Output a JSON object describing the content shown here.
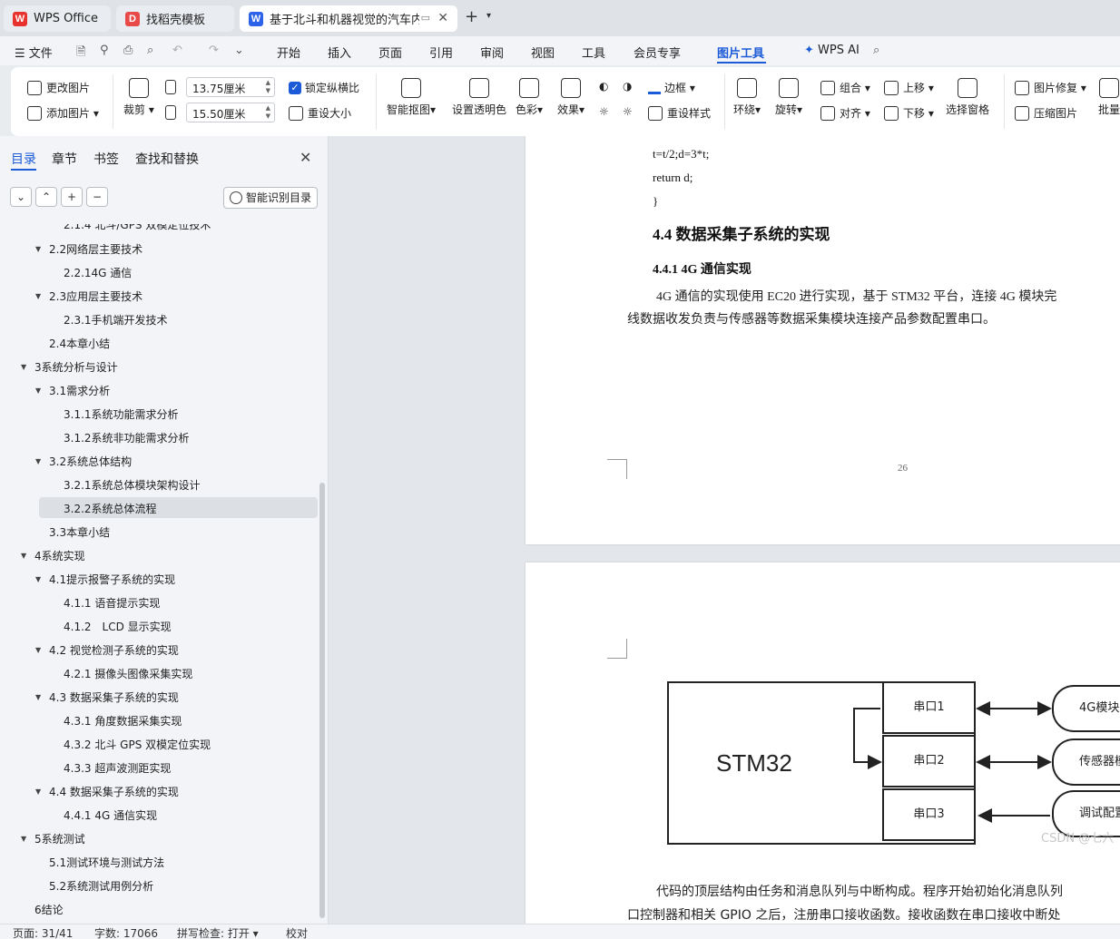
{
  "tabs": [
    {
      "label": "WPS Office",
      "icon": "wps-logo-icon"
    },
    {
      "label": "找稻壳模板",
      "icon": "docer-icon"
    },
    {
      "label": "基于北斗和机器视觉的汽车内外",
      "icon": "writer-doc-icon"
    }
  ],
  "menu": {
    "file": "文件",
    "items": [
      "开始",
      "插入",
      "页面",
      "引用",
      "审阅",
      "视图",
      "工具",
      "会员专享",
      "图片工具"
    ],
    "active": "图片工具",
    "wps_ai": "WPS AI"
  },
  "ribbon": {
    "change_image": "更改图片",
    "add_image": "添加图片",
    "crop": "裁剪",
    "width_value": "13.75厘米",
    "height_value": "15.50厘米",
    "lock_ratio": "锁定纵横比",
    "reset_size": "重设大小",
    "smart_cutout": "智能抠图",
    "set_transparent": "设置透明色",
    "color": "色彩",
    "effect": "效果",
    "border": "边框",
    "reset_style": "重设样式",
    "wrap": "环绕",
    "rotate": "旋转",
    "group": "组合",
    "align": "对齐",
    "bring_forward": "上移",
    "send_backward": "下移",
    "selection_pane": "选择窗格",
    "image_repair": "图片修复",
    "compress": "压缩图片",
    "batch": "批量"
  },
  "nav": {
    "tabs": [
      "目录",
      "章节",
      "书签",
      "查找和替换"
    ],
    "smart_toc": "智能识别目录",
    "toc": [
      {
        "level": 3,
        "text": "2.1.4 北斗/GPS 双模定位技术"
      },
      {
        "level": 2,
        "text": "2.2网络层主要技术",
        "expanded": true
      },
      {
        "level": 3,
        "text": "2.2.14G 通信"
      },
      {
        "level": 2,
        "text": "2.3应用层主要技术",
        "expanded": true
      },
      {
        "level": 3,
        "text": "2.3.1手机端开发技术"
      },
      {
        "level": 2,
        "text": "2.4本章小结"
      },
      {
        "level": 1,
        "text": "3系统分析与设计",
        "expanded": true
      },
      {
        "level": 2,
        "text": "3.1需求分析",
        "expanded": true
      },
      {
        "level": 3,
        "text": "3.1.1系统功能需求分析"
      },
      {
        "level": 3,
        "text": "3.1.2系统非功能需求分析"
      },
      {
        "level": 2,
        "text": "3.2系统总体结构",
        "expanded": true
      },
      {
        "level": 3,
        "text": "3.2.1系统总体模块架构设计"
      },
      {
        "level": 3,
        "text": "3.2.2系统总体流程",
        "selected": true
      },
      {
        "level": 2,
        "text": "3.3本章小结"
      },
      {
        "level": 1,
        "text": "4系统实现",
        "expanded": true
      },
      {
        "level": 2,
        "text": "4.1提示报警子系统的实现",
        "expanded": true
      },
      {
        "level": 3,
        "text": "4.1.1 语音提示实现"
      },
      {
        "level": 3,
        "text": "4.1.2　LCD 显示实现"
      },
      {
        "level": 2,
        "text": "4.2 视觉检测子系统的实现",
        "expanded": true
      },
      {
        "level": 3,
        "text": "4.2.1 摄像头图像采集实现"
      },
      {
        "level": 2,
        "text": "4.3 数据采集子系统的实现",
        "expanded": true
      },
      {
        "level": 3,
        "text": "4.3.1 角度数据采集实现"
      },
      {
        "level": 3,
        "text": "4.3.2 北斗 GPS 双模定位实现"
      },
      {
        "level": 3,
        "text": "4.3.3 超声波测距实现"
      },
      {
        "level": 2,
        "text": "4.4 数据采集子系统的实现",
        "expanded": true
      },
      {
        "level": 3,
        "text": "4.4.1 4G 通信实现"
      },
      {
        "level": 1,
        "text": "5系统测试",
        "expanded": true
      },
      {
        "level": 2,
        "text": "5.1测试环境与测试方法"
      },
      {
        "level": 2,
        "text": "5.2系统测试用例分析"
      },
      {
        "level": 1,
        "text": "6结论"
      }
    ]
  },
  "doc": {
    "code_lines": [
      "t=t/2;d=3*t;",
      "return d;",
      "}"
    ],
    "heading_44": "4.4 数据采集子系统的实现",
    "heading_441": "4.4.1 4G 通信实现",
    "para1_line1": "4G 通信的实现使用 EC20 进行实现，基于 STM32 平台，连接 4G 模块完",
    "para1_line2": "线数据收发负责与传感器等数据采集模块连接产品参数配置串口。",
    "page_number": "26",
    "diagram": {
      "main": "STM32",
      "ports": [
        "串口1",
        "串口2",
        "串口3"
      ],
      "modules": [
        "4G模块",
        "传感器模",
        "调试配置串"
      ]
    },
    "watermark": "CSDN @七六",
    "para2_line1": "代码的顶层结构由任务和消息队列与中断构成。程序开始初始化消息队列",
    "para2_line2": "口控制器和相关 GPIO 之后，注册串口接收函数。接收函数在串口接收中断处"
  },
  "status": {
    "page": "页面: 31/41",
    "words": "字数: 17066",
    "spell": "拼写检查: 打开",
    "proof": "校对"
  },
  "colors": {
    "accent": "#1c5bd8",
    "wps_red": "#e8322d",
    "docer_red": "#e84a4a",
    "writer_blue": "#2d63e8"
  }
}
